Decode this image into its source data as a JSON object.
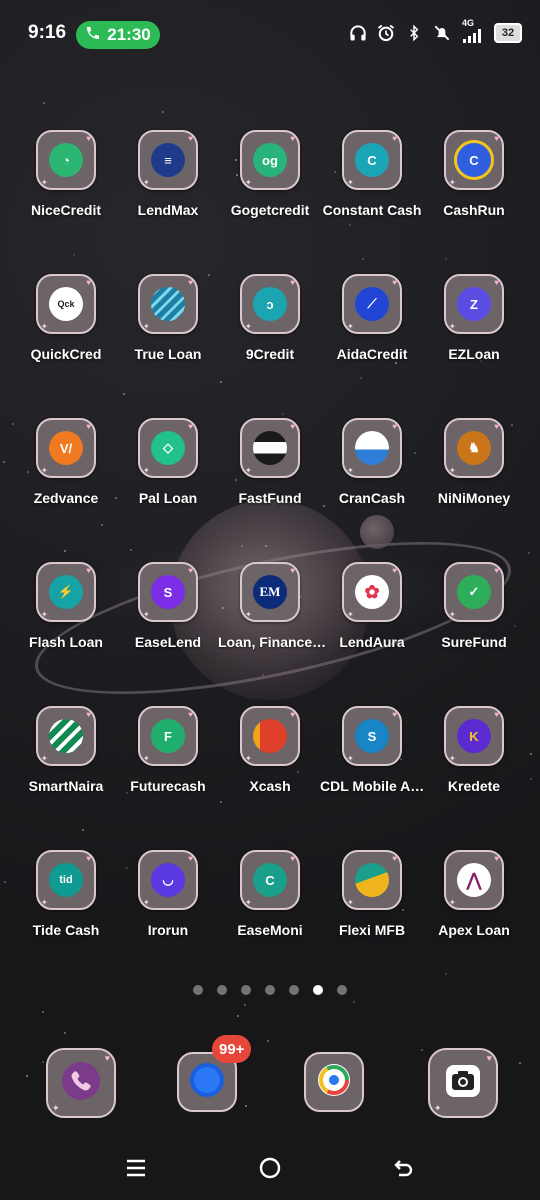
{
  "status_bar": {
    "time": "9:16",
    "call_timer": "21:30",
    "network": "4G",
    "battery_level": "32",
    "icons": [
      "headphones-icon",
      "alarm-icon",
      "bluetooth-icon",
      "mute-icon",
      "signal-icon",
      "battery-icon"
    ]
  },
  "apps": [
    {
      "label": "NiceCredit",
      "color": "#2bb673"
    },
    {
      "label": "LendMax",
      "color": "#1f3a8a"
    },
    {
      "label": "Gogetcredit",
      "color": "#27b37a"
    },
    {
      "label": "Constant Cash",
      "color": "#1ba6b8"
    },
    {
      "label": "CashRun",
      "color": "#2f5fe0"
    },
    {
      "label": "QuickCred",
      "color": "#ffffff"
    },
    {
      "label": "True Loan",
      "color": "#1d7fa5"
    },
    {
      "label": "9Credit",
      "color": "#1aa5b0"
    },
    {
      "label": "AidaCredit",
      "color": "#2146d6"
    },
    {
      "label": "EZLoan",
      "color": "#5b4de2"
    },
    {
      "label": "Zedvance",
      "color": "#f07a1f"
    },
    {
      "label": "Pal Loan",
      "color": "#22c08d"
    },
    {
      "label": "FastFund",
      "color": "#1a1a1a"
    },
    {
      "label": "CranCash",
      "color": "#2f7fd8"
    },
    {
      "label": "NiNiMoney",
      "color": "#c9761b"
    },
    {
      "label": "Flash Loan",
      "color": "#15a3a6"
    },
    {
      "label": "EaseLend",
      "color": "#7b2ee6"
    },
    {
      "label": "Loan, Finance…",
      "color": "#0c2c7a"
    },
    {
      "label": "LendAura",
      "color": "#e2344e"
    },
    {
      "label": "SureFund",
      "color": "#2eae5a"
    },
    {
      "label": "SmartNaira",
      "color": "#0f8a52"
    },
    {
      "label": "Futurecash",
      "color": "#1fae6e"
    },
    {
      "label": "Xcash",
      "color": "#e0402a"
    },
    {
      "label": "CDL Mobile A…",
      "color": "#1785c6"
    },
    {
      "label": "Kredete",
      "color": "#5b2ad1"
    },
    {
      "label": "Tide Cash",
      "color": "#0f9a92"
    },
    {
      "label": "Irorun",
      "color": "#5a3ae0"
    },
    {
      "label": "EaseMoni",
      "color": "#1a9f8a"
    },
    {
      "label": "Flexi MFB",
      "color": "#f0b41c"
    },
    {
      "label": "Apex Loan",
      "color": "#8a1c63"
    }
  ],
  "page_indicator": {
    "count": 7,
    "active": 6
  },
  "dock": {
    "apps": [
      "phone",
      "messages",
      "chrome",
      "camera"
    ],
    "badge": "99+"
  },
  "nav": [
    "recents",
    "home",
    "back"
  ]
}
